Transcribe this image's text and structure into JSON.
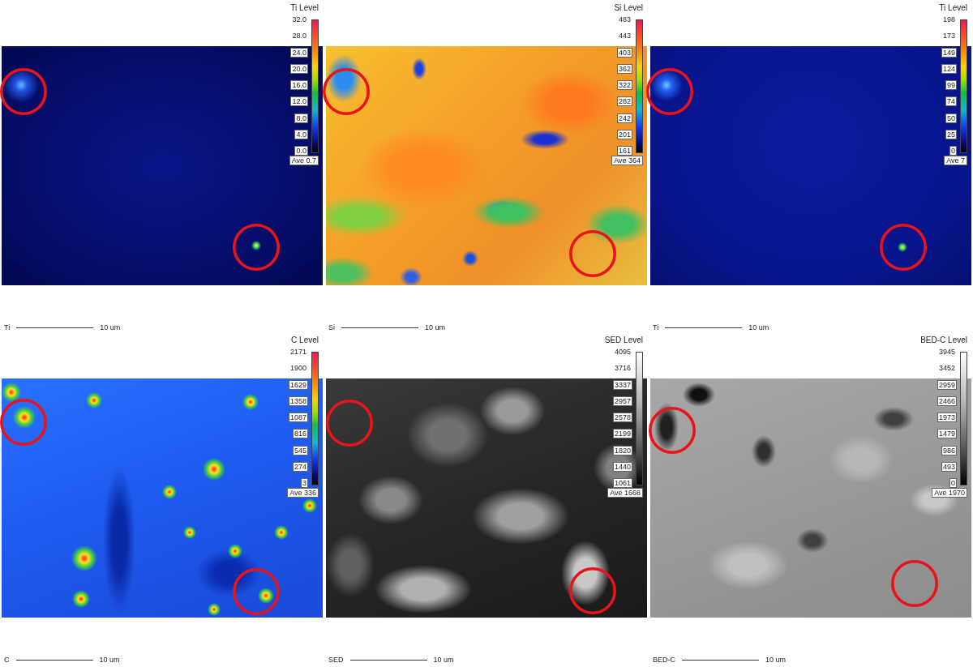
{
  "panels": [
    {
      "colorbar": {
        "title": "Ti Level",
        "kind": "rainbow",
        "ticks": [
          "32.0",
          "28.0",
          "24.0",
          "20.0",
          "16.0",
          "12.0",
          "8.0",
          "4.0",
          "0.0"
        ],
        "average": "Ave 0.7"
      },
      "label": "Ti",
      "scale": "10 um"
    },
    {
      "colorbar": {
        "title": "Si Level",
        "kind": "rainbow",
        "ticks": [
          "483",
          "443",
          "403",
          "362",
          "322",
          "282",
          "242",
          "201",
          "161"
        ],
        "average": "Ave 364"
      },
      "label": "Si",
      "scale": "10 um"
    },
    {
      "colorbar": {
        "title": "Ti Level",
        "kind": "rainbow",
        "ticks": [
          "198",
          "173",
          "149",
          "124",
          "99",
          "74",
          "50",
          "25",
          "0"
        ],
        "average": "Ave 7"
      },
      "label": "Ti",
      "scale": "10 um"
    },
    {
      "colorbar": {
        "title": "C Level",
        "kind": "rainbow",
        "ticks": [
          "2171",
          "1900",
          "1629",
          "1358",
          "1087",
          "816",
          "545",
          "274",
          "3"
        ],
        "average": "Ave 336"
      },
      "label": "C",
      "scale": "10 um"
    },
    {
      "colorbar": {
        "title": "SED Level",
        "kind": "gray",
        "ticks": [
          "4095",
          "3716",
          "3337",
          "2957",
          "2578",
          "2199",
          "1820",
          "1440",
          "1061"
        ],
        "average": "Ave 1668"
      },
      "label": "SED",
      "scale": "10 um"
    },
    {
      "colorbar": {
        "title": "BED-C Level",
        "kind": "gray",
        "ticks": [
          "3945",
          "3452",
          "2959",
          "2466",
          "1973",
          "1479",
          "986",
          "493",
          "0"
        ],
        "average": "Ave 1970"
      },
      "label": "BED-C",
      "scale": "10 um"
    }
  ]
}
